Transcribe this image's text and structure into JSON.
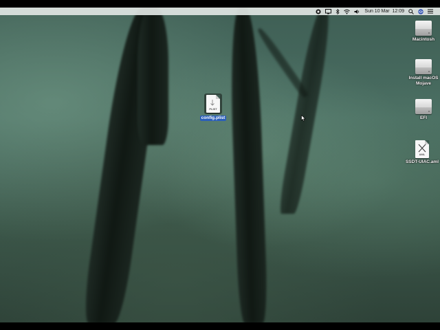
{
  "menubar": {
    "items": [
      {
        "name": "screen-record-icon"
      },
      {
        "name": "display-icon"
      },
      {
        "name": "bluetooth-icon"
      },
      {
        "name": "wifi-icon"
      },
      {
        "name": "volume-icon"
      }
    ],
    "clock": "Sun 10 Mar  12:09",
    "right_icons": [
      "search-icon",
      "siri-icon",
      "notification-center-icon"
    ]
  },
  "desktop": {
    "icons": [
      {
        "label": "Macintosh",
        "type": "drive"
      },
      {
        "label": "Install macOS\nMojave",
        "type": "drive"
      },
      {
        "label": "EFI",
        "type": "drive"
      },
      {
        "label": "SSDT-UIAC.aml",
        "type": "document",
        "tag": "AML"
      }
    ],
    "selected_file": {
      "label": "config.plist",
      "tag": "PLIST"
    }
  },
  "colors": {
    "menubar_bg": "#e1e6e4",
    "selection": "#2b5fb8",
    "letterbox": "#000000"
  }
}
